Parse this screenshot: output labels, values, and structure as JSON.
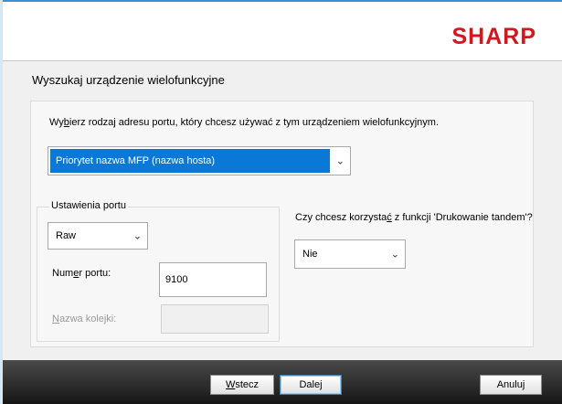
{
  "header": {
    "logo_text": "SHARP",
    "brand_color": "#d6161f"
  },
  "page": {
    "title": "Wyszukaj urządzenie wielofunkcyjne"
  },
  "main": {
    "instruction": "Wybierz rodzaj adresu portu, który chcesz używać z tym urządzeniem wielofunkcyjnym.",
    "address_type": {
      "selected": "Priorytet nazwa MFP (nazwa hosta)",
      "icon": "chevron-down-icon"
    }
  },
  "port_settings": {
    "legend": "Ustawienia portu",
    "protocol": {
      "selected": "Raw",
      "icon": "chevron-down-icon"
    },
    "port_number_label": "Numer portu:",
    "port_number_value": "9100",
    "queue_name_label": "Nazwa kolejki:",
    "queue_name_value": ""
  },
  "tandem": {
    "question": "Czy chcesz korzystać z funkcji 'Drukowanie tandem'?",
    "selected": "Nie",
    "icon": "chevron-down-icon"
  },
  "footer": {
    "back_label": "Wstecz",
    "next_label": "Dalej",
    "cancel_label": "Anuluj"
  },
  "colors": {
    "accent": "#0a78d7",
    "footer_bg": "#1e1e1e",
    "content_bg": "#f0f0f0"
  }
}
